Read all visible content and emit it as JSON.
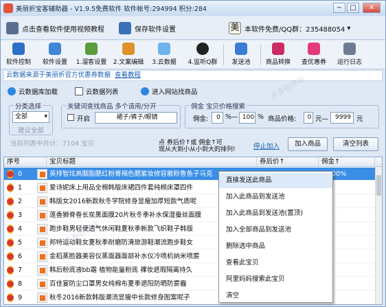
{
  "window": {
    "title": "美丽折宝客辅助器 - V1.9.5免费软件  软件帐号:294994 积分:284",
    "min": "−",
    "max": "□",
    "close": "✕"
  },
  "topbar": {
    "video_btn": "点击查看软件使用视频教程",
    "save_btn": "保存软件设置",
    "user_text": "本软件免费/QQ群：235488054",
    "user_dropdown": "▾"
  },
  "toolbar": [
    "软件控制",
    "软件设置",
    "1.溜客设置",
    "2.文案编辑",
    "3.云数据",
    "4.监听Q群",
    "发送池",
    "商品转换",
    "查优惠券",
    "运行日志"
  ],
  "notice": {
    "text": "云数据来源于美丽折官方优惠券数据",
    "link": "查看教程"
  },
  "tabs": [
    "云数据库加载",
    "云数据列表",
    "进入网站找商品"
  ],
  "filters": {
    "category_legend": "分类选择",
    "category_value": "全部",
    "build_all": "建议全部",
    "keyword_legend": "关键词查找商品  多个请用/分开",
    "enable_label": "开启",
    "keyword_value": "裙子/裤子/眼镜",
    "commission_legend": "佣金 宝贝价格搜索",
    "commission_label": "佣金:",
    "commission_from": "0",
    "percent_to": "%—",
    "commission_to": "100",
    "percent": "%",
    "price_label": "商品价格:",
    "price_from": "0",
    "yuan_to": "元—",
    "price_to": "9999",
    "yuan": "元"
  },
  "list_toolbar": {
    "total": "当前列表中共计：7104 宝贝",
    "sort_hint_1": "点   券后价↑或 佣金↑可",
    "sort_hint_2": "现从大到小从小到大的排列!",
    "stop_add": "停止加入",
    "add_goods": "加入商品",
    "clear_list": "清空列表"
  },
  "grid": {
    "headers": [
      "序号",
      "宝贝标题",
      "券后价↑",
      "佣金↑"
    ],
    "rows": [
      {
        "no": "0",
        "title": "英排智炫高胭脂腮红粉膏褐色腮紫妆修容散粉鲁鱼子马克",
        "price": "10…",
        "comm": "36.00%"
      },
      {
        "no": "1",
        "title": "爱诗妮床上用品全棉韩版床裙四件套纯棉床罩四件",
        "price": "",
        "comm": "%"
      },
      {
        "no": "2",
        "title": "韩版女2016新款秋冬学院修身显瘦加厚短款气质呢",
        "price": "",
        "comm": "%"
      },
      {
        "no": "3",
        "title": "莲香狮脊卷长炭黑面膜20片秋冬季补水保湿蚕丝面膜",
        "price": "",
        "comm": "%"
      },
      {
        "no": "4",
        "title": "跑步鞋男轻便透气休闲鞋夏秋季新款飞织鞋子韩版",
        "price": "",
        "comm": "%"
      },
      {
        "no": "5",
        "title": "邦特运动鞋女夏秋季耐磨防滑旅游鞋潮流跑步鞋女",
        "price": "",
        "comm": "%"
      },
      {
        "no": "6",
        "title": "金稻蒸脸器美容仪蒸面器面部补水仪冷喷机纳米喷雾",
        "price": "",
        "comm": "%"
      },
      {
        "no": "7",
        "title": "韩后粉底液bb霜 植物能量粉底 裸妆遮瑕隔离持久",
        "price": "",
        "comm": "%"
      },
      {
        "no": "8",
        "title": "百佳宴防尘口罩男女纯棉布夏季遮阳防晒防雾霾",
        "price": "",
        "comm": "%"
      },
      {
        "no": "9",
        "title": "秋冬2016新款韩版潮流显瘦中长款修身图案呢子",
        "price": "",
        "comm": "%"
      }
    ]
  },
  "context_menu": [
    "直接发送此商品",
    "加入此商品到发送池",
    "加入此商品到发送池(置顶)",
    "加入全部商品到发送池",
    "删除选中商品",
    "查看此宝贝",
    "阿里妈妈搜索此宝贝",
    "清空"
  ],
  "colors": {
    "accent": "#3a8ee6",
    "link": "#1a5fb4"
  }
}
